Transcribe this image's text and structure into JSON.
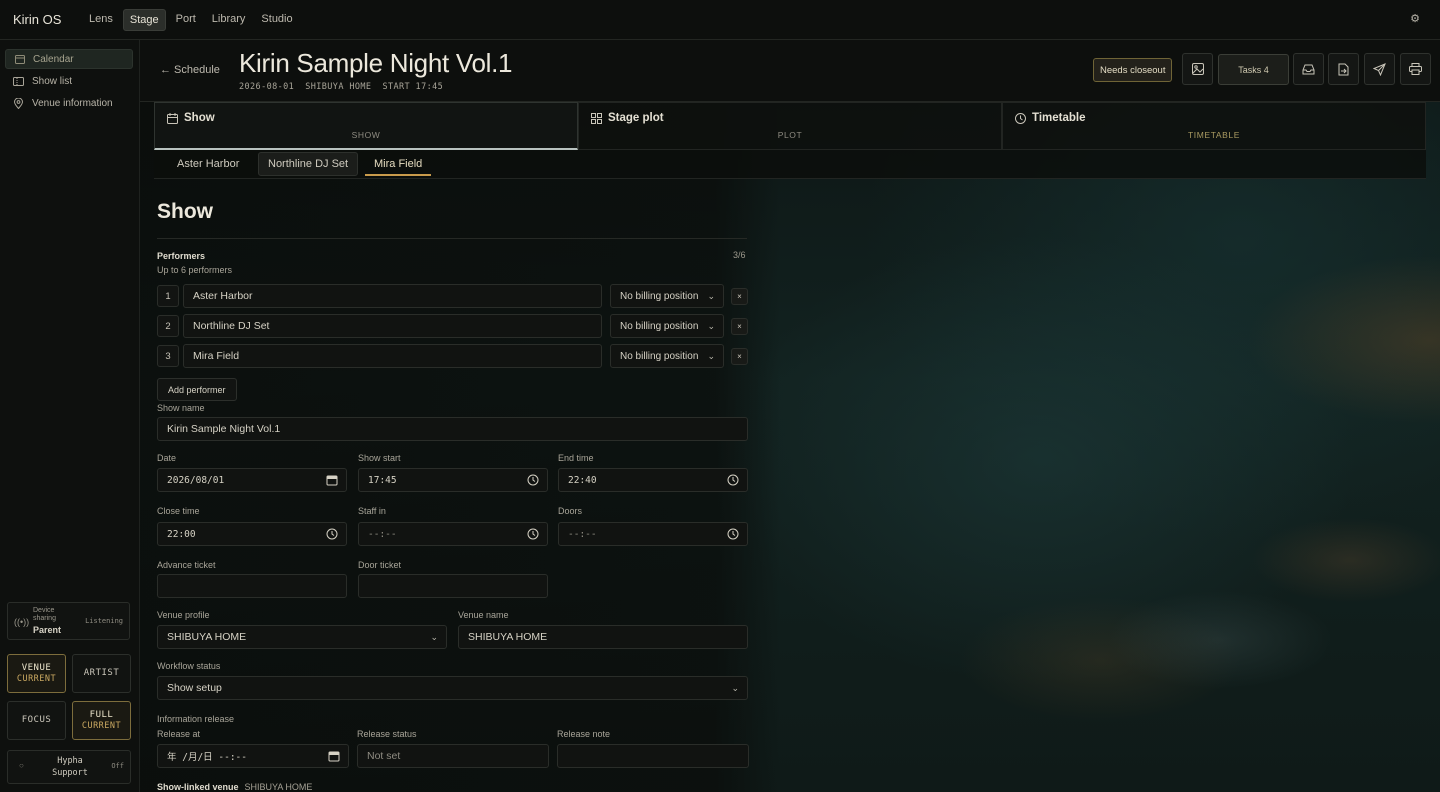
{
  "app": {
    "brand": "Kirin OS",
    "nav": [
      "Lens",
      "Stage",
      "Port",
      "Library",
      "Studio"
    ],
    "active_nav": "Stage"
  },
  "sidebar": {
    "items": [
      {
        "label": "Calendar",
        "icon": "calendar-icon"
      },
      {
        "label": "Show list",
        "icon": "ticket-icon"
      },
      {
        "label": "Venue information",
        "icon": "location-pin-icon"
      }
    ],
    "device_sharing": {
      "small": "Device sharing",
      "role": "Parent",
      "status": "Listening"
    },
    "modes": {
      "venue": {
        "label": "VENUE",
        "sub": "CURRENT"
      },
      "artist": {
        "label": "ARTIST"
      },
      "focus": {
        "label": "FOCUS"
      },
      "full": {
        "label": "FULL",
        "sub": "CURRENT"
      }
    },
    "hypha": {
      "line1": "Hypha",
      "line2": "Support",
      "status": "Off"
    }
  },
  "header": {
    "back": "← Schedule",
    "title": "Kirin Sample Night Vol.1",
    "subtitle": "2026-08-01  SHIBUYA HOME  START 17:45",
    "badge": "Needs closeout",
    "tasks": "Tasks 4"
  },
  "main_tabs": [
    {
      "label": "Show",
      "sub": "SHOW",
      "icon": "calendar-icon"
    },
    {
      "label": "Stage plot",
      "sub": "PLOT",
      "icon": "grid-icon"
    },
    {
      "label": "Timetable",
      "sub": "TIMETABLE",
      "icon": "clock-icon"
    }
  ],
  "performer_tabs": [
    "Aster Harbor",
    "Northline DJ Set",
    "Mira Field"
  ],
  "form": {
    "heading": "Show",
    "performers_label": "Performers",
    "performers_hint": "Up to 6 performers",
    "performers_count": "3/6",
    "performers": [
      {
        "index": "1",
        "name": "Aster Harbor",
        "billing": "No billing position"
      },
      {
        "index": "2",
        "name": "Northline DJ Set",
        "billing": "No billing position"
      },
      {
        "index": "3",
        "name": "Mira Field",
        "billing": "No billing position"
      }
    ],
    "remove_glyph": "×",
    "add_performer": "Add performer",
    "show_name_label": "Show name",
    "show_name": "Kirin Sample Night Vol.1",
    "date_label": "Date",
    "date": "2026/08/01",
    "show_start_label": "Show start",
    "show_start": "17:45",
    "end_time_label": "End time",
    "end_time": "22:40",
    "close_time_label": "Close time",
    "close_time": "22:00",
    "staff_in_label": "Staff in",
    "staff_in": "--:--",
    "doors_label": "Doors",
    "doors": "--:--",
    "advance_ticket_label": "Advance ticket",
    "door_ticket_label": "Door ticket",
    "venue_profile_label": "Venue profile",
    "venue_profile": "SHIBUYA HOME",
    "venue_name_label": "Venue name",
    "venue_name": "SHIBUYA HOME",
    "workflow_label": "Workflow status",
    "workflow": "Show setup",
    "info_release_label": "Information release",
    "release_at_label": "Release at",
    "release_at": "年 /月/日 --:--",
    "release_status_label": "Release status",
    "release_status": "Not set",
    "release_note_label": "Release note",
    "linked_venue_label": "Show-linked venue",
    "linked_venue": "SHIBUYA HOME"
  },
  "colors": {
    "accent_gold": "#c99b4c",
    "badge_border": "#6f6436",
    "bg": "#0b0f0d"
  }
}
